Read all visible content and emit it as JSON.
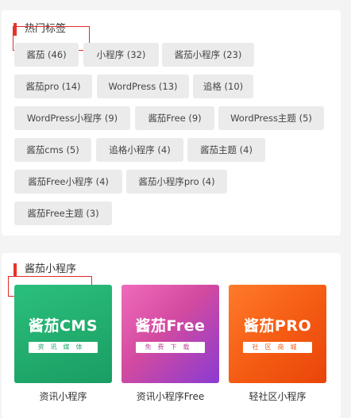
{
  "hot_tags": {
    "title": "热门标签",
    "tags": [
      {
        "label": "酱茄 (46)"
      },
      {
        "label": "小程序 (32)"
      },
      {
        "label": "酱茄小程序 (23)"
      },
      {
        "label": "酱茄pro (14)"
      },
      {
        "label": "WordPress (13)"
      },
      {
        "label": "追格 (10)"
      },
      {
        "label": "WordPress小程序 (9)"
      },
      {
        "label": "酱茄Free (9)"
      },
      {
        "label": "WordPress主题 (5)"
      },
      {
        "label": "酱茄cms (5)"
      },
      {
        "label": "追格小程序 (4)"
      },
      {
        "label": "酱茄主题 (4)"
      },
      {
        "label": "酱茄Free小程序 (4)"
      },
      {
        "label": "酱茄小程序pro (4)"
      },
      {
        "label": "酱茄Free主题 (3)"
      }
    ]
  },
  "apps": {
    "title": "酱茄小程序",
    "items": [
      {
        "logo": "酱茄CMS",
        "subtitle": "资讯媒体",
        "caption": "资讯小程序",
        "color": "#1fa86b",
        "sub_color": "#1fa86b"
      },
      {
        "logo": "酱茄Free",
        "subtitle": "免费下载",
        "caption": "资讯小程序Free",
        "color": "#d9468f",
        "sub_color": "#c2459a"
      },
      {
        "logo": "酱茄PRO",
        "subtitle": "社区商城",
        "caption": "轻社区小程序",
        "color": "#f45a12",
        "sub_color": "#f45a12"
      }
    ]
  }
}
